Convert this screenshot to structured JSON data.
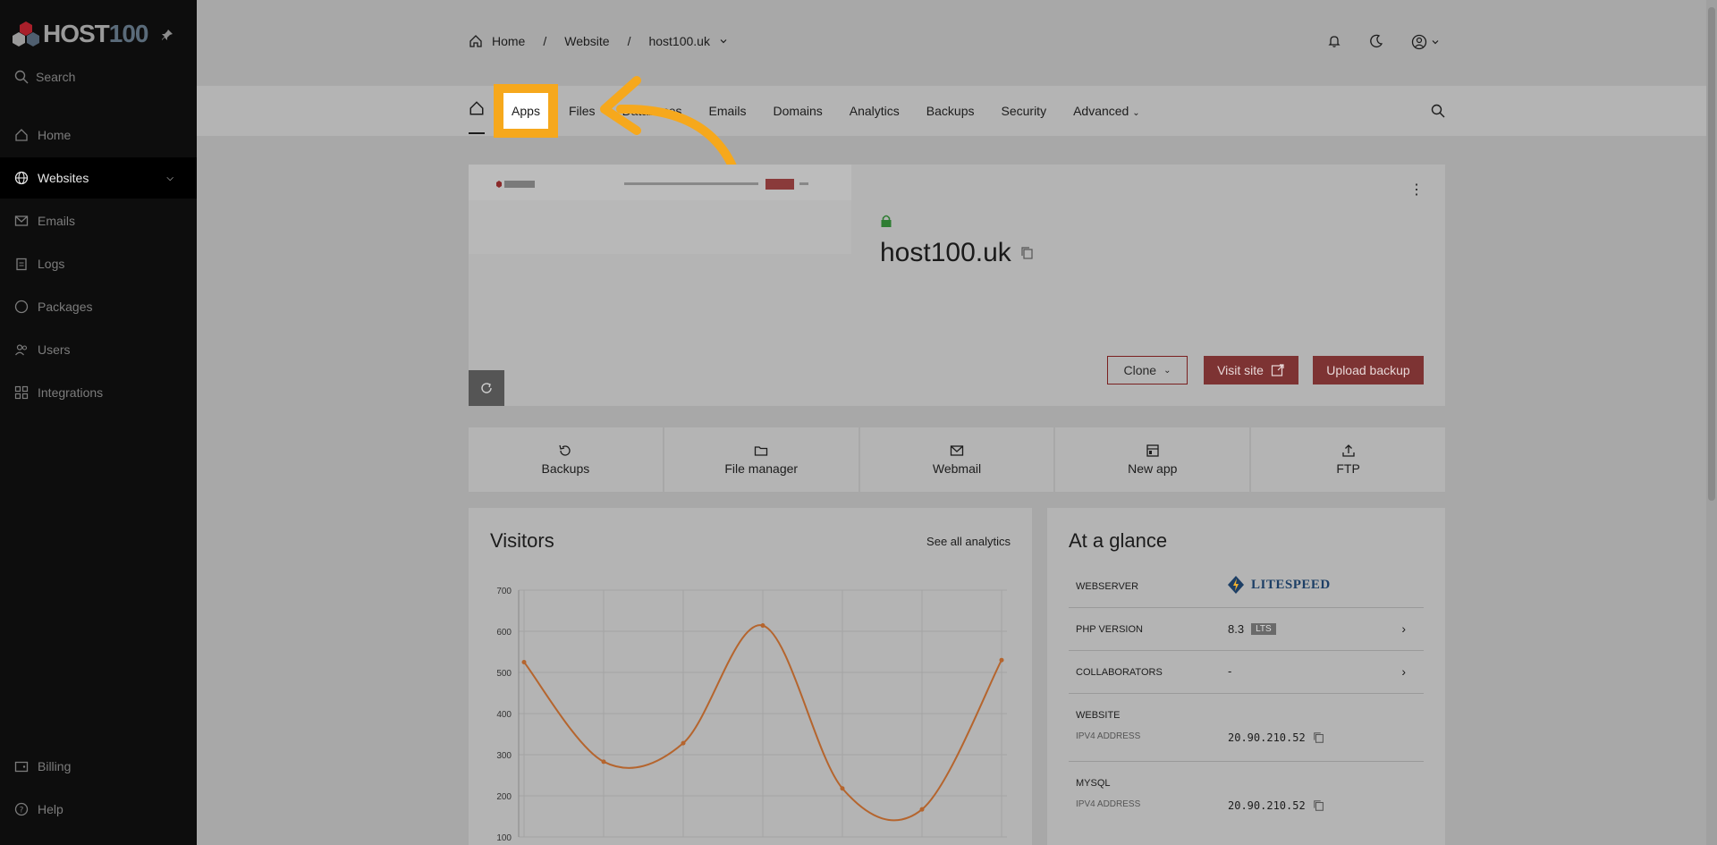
{
  "sidebar": {
    "logo_main": "HOST",
    "logo_num": "100",
    "search_label": "Search",
    "items": [
      {
        "label": "Home"
      },
      {
        "label": "Websites"
      },
      {
        "label": "Emails"
      },
      {
        "label": "Logs"
      },
      {
        "label": "Packages"
      },
      {
        "label": "Users"
      },
      {
        "label": "Integrations"
      }
    ],
    "bottom": [
      {
        "label": "Billing"
      },
      {
        "label": "Help"
      }
    ]
  },
  "breadcrumb": {
    "home": "Home",
    "website": "Website",
    "domain": "host100.uk",
    "sep": "/"
  },
  "tabs": {
    "apps": "Apps",
    "files": "Files",
    "databases": "Databases",
    "emails": "Emails",
    "domains": "Domains",
    "analytics": "Analytics",
    "backups": "Backups",
    "security": "Security",
    "advanced": "Advanced"
  },
  "site": {
    "domain": "host100.uk",
    "clone_label": "Clone",
    "visit_label": "Visit site",
    "upload_label": "Upload backup"
  },
  "quick": [
    {
      "label": "Backups",
      "icon": "restore-icon"
    },
    {
      "label": "File manager",
      "icon": "folder-icon"
    },
    {
      "label": "Webmail",
      "icon": "mail-icon"
    },
    {
      "label": "New app",
      "icon": "app-icon"
    },
    {
      "label": "FTP",
      "icon": "upload-icon"
    }
  ],
  "visitors": {
    "title": "Visitors",
    "see_all": "See all analytics"
  },
  "chart_data": {
    "type": "line",
    "title": "",
    "xlabel": "",
    "ylabel": "",
    "ylim": [
      100,
      700
    ],
    "yticks": [
      700,
      600,
      500,
      400,
      300,
      200,
      100
    ],
    "x": [
      0,
      1,
      2,
      3,
      4,
      5,
      6
    ],
    "series": [
      {
        "values": [
          525,
          283,
          328,
          614,
          218,
          167,
          530
        ]
      }
    ],
    "color": "#b5652e",
    "grid": true
  },
  "glance": {
    "title": "At a glance",
    "webserver_label": "WEBSERVER",
    "webserver_value": "LITESPEED",
    "php_label": "PHP VERSION",
    "php_value": "8.3",
    "php_badge": "LTS",
    "collab_label": "COLLABORATORS",
    "collab_value": "-",
    "website_label": "WEBSITE",
    "website_sub": "IPV4 ADDRESS",
    "website_ip": "20.90.210.52",
    "mysql_label": "MYSQL",
    "mysql_sub": "IPV4 ADDRESS",
    "mysql_ip": "20.90.210.52"
  },
  "colors": {
    "accent": "#f6a81c",
    "brand_red": "#7d3333",
    "sidebar_bg": "#0d0d0d"
  }
}
